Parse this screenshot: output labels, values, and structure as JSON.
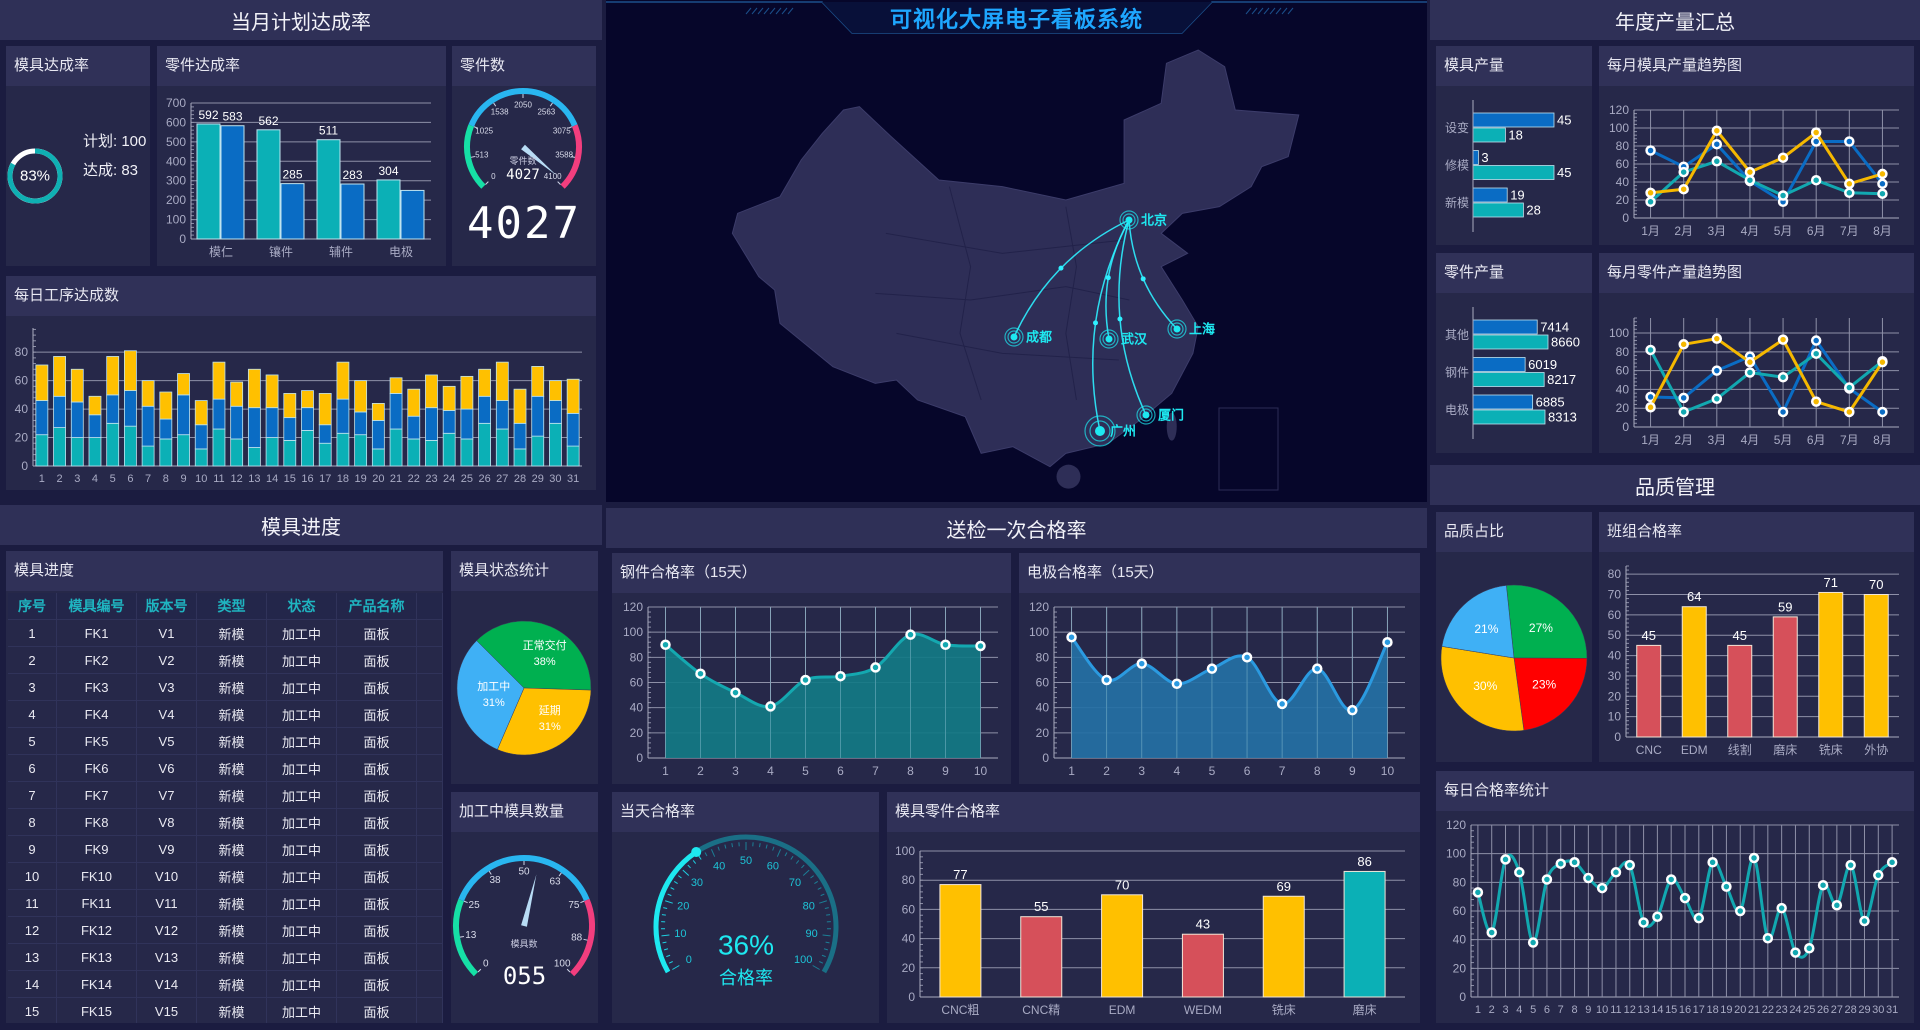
{
  "header": {
    "title": "可视化大屏电子看板系统"
  },
  "sections": {
    "monthly_plan": "当月计划达成率",
    "mold_progress": "模具进度",
    "inspection": "送检一次合格率",
    "annual_output": "年度产量汇总",
    "quality": "品质管理"
  },
  "colors": {
    "teal": "#0bb0b6",
    "blue": "#0a6cc4",
    "yellow": "#ffc000",
    "red": "#d6505a",
    "cyan": "#1ee8f0",
    "green": "#00b050",
    "light_blue": "#3fb0f5",
    "pie_red": "#ff0000"
  },
  "mold_rate": {
    "title": "模具达成率",
    "value": 83,
    "percent": "83%",
    "plan": "计划: 100",
    "done": "达成: 83"
  },
  "part_count": {
    "title": "零件数",
    "value": 4027,
    "max": 4100,
    "display": "4027",
    "gauge_label": "零件数",
    "ticks": [
      0,
      513,
      1025,
      1538,
      2050,
      2563,
      3075,
      3588,
      4100
    ]
  },
  "mold_table": {
    "title": "模具进度",
    "columns": [
      "序号",
      "模具编号",
      "版本号",
      "类型",
      "状态",
      "产品名称"
    ],
    "rows": [
      [
        "1",
        "FK1",
        "V1",
        "新模",
        "加工中",
        "面板"
      ],
      [
        "2",
        "FK2",
        "V2",
        "新模",
        "加工中",
        "面板"
      ],
      [
        "3",
        "FK3",
        "V3",
        "新模",
        "加工中",
        "面板"
      ],
      [
        "4",
        "FK4",
        "V4",
        "新模",
        "加工中",
        "面板"
      ],
      [
        "5",
        "FK5",
        "V5",
        "新模",
        "加工中",
        "面板"
      ],
      [
        "6",
        "FK6",
        "V6",
        "新模",
        "加工中",
        "面板"
      ],
      [
        "7",
        "FK7",
        "V7",
        "新模",
        "加工中",
        "面板"
      ],
      [
        "8",
        "FK8",
        "V8",
        "新模",
        "加工中",
        "面板"
      ],
      [
        "9",
        "FK9",
        "V9",
        "新模",
        "加工中",
        "面板"
      ],
      [
        "10",
        "FK10",
        "V10",
        "新模",
        "加工中",
        "面板"
      ],
      [
        "11",
        "FK11",
        "V11",
        "新模",
        "加工中",
        "面板"
      ],
      [
        "12",
        "FK12",
        "V12",
        "新模",
        "加工中",
        "面板"
      ],
      [
        "13",
        "FK13",
        "V13",
        "新模",
        "加工中",
        "面板"
      ],
      [
        "14",
        "FK14",
        "V14",
        "新模",
        "加工中",
        "面板"
      ],
      [
        "15",
        "FK15",
        "V15",
        "新模",
        "加工中",
        "面板"
      ]
    ]
  },
  "mold_gauge": {
    "title": "加工中模具数量",
    "value": 55,
    "max": 100,
    "display": "055",
    "gauge_label": "模具数",
    "ticks": [
      0,
      13,
      25,
      38,
      50,
      63,
      75,
      88,
      100
    ]
  },
  "today_rate": {
    "title": "当天合格率",
    "value": 36,
    "display": "36%",
    "label": "合格率",
    "ticks": [
      0,
      10,
      20,
      30,
      40,
      50,
      60,
      70,
      80,
      90,
      100
    ]
  },
  "map": {
    "cities": [
      "北京",
      "成都",
      "武汉",
      "上海",
      "厦门",
      "广州"
    ],
    "routes": [
      [
        "北京",
        "成都"
      ],
      [
        "北京",
        "武汉"
      ],
      [
        "北京",
        "上海"
      ],
      [
        "北京",
        "厦门"
      ],
      [
        "北京",
        "广州"
      ]
    ]
  },
  "chart_data": [
    {
      "type": "bar",
      "title": "零件达成率",
      "categories": [
        "模仁",
        "镶件",
        "辅件",
        "电极"
      ],
      "ylim": [
        0,
        700
      ],
      "yticks": [
        0,
        100,
        200,
        300,
        400,
        500,
        600,
        700
      ],
      "grid": true,
      "series": [
        {
          "values": [
            592,
            562,
            511,
            304
          ],
          "color": "#0bb0b6",
          "labels": [
            "592",
            "562",
            "511",
            "304"
          ]
        },
        {
          "values": [
            583,
            285,
            283,
            250
          ],
          "color": "#0a6cc4",
          "labels": [
            "583",
            "285",
            "283",
            ""
          ]
        }
      ]
    },
    {
      "type": "bar",
      "stacked": true,
      "title": "每日工序达成数",
      "categories": [
        "1",
        "2",
        "3",
        "4",
        "5",
        "6",
        "7",
        "8",
        "9",
        "10",
        "11",
        "12",
        "13",
        "14",
        "15",
        "16",
        "17",
        "18",
        "19",
        "20",
        "21",
        "22",
        "23",
        "24",
        "25",
        "26",
        "27",
        "28",
        "29",
        "30",
        "31"
      ],
      "ylim": [
        0,
        97
      ],
      "yticks": [
        0,
        20,
        40,
        60,
        80
      ],
      "grid": true,
      "series": [
        {
          "color": "#0bb0b6",
          "values": [
            22,
            27,
            20,
            20,
            30,
            28,
            14,
            19,
            22,
            12,
            26,
            19,
            13,
            20,
            18,
            25,
            16,
            23,
            22,
            12,
            26,
            19,
            18,
            23,
            19,
            30,
            26,
            12,
            21,
            30,
            14
          ]
        },
        {
          "color": "#0a6cc4",
          "values": [
            24,
            22,
            25,
            16,
            20,
            25,
            28,
            14,
            28,
            17,
            21,
            23,
            28,
            21,
            16,
            16,
            13,
            24,
            16,
            20,
            25,
            16,
            23,
            16,
            21,
            19,
            20,
            18,
            28,
            16,
            23
          ]
        },
        {
          "color": "#ffc000",
          "values": [
            25,
            28,
            23,
            13,
            27,
            28,
            18,
            19,
            15,
            17,
            26,
            17,
            27,
            23,
            17,
            12,
            22,
            26,
            22,
            12,
            11,
            19,
            23,
            17,
            23,
            19,
            27,
            24,
            21,
            14,
            24
          ]
        }
      ]
    },
    {
      "type": "bar",
      "orientation": "horizontal",
      "title": "模具产量",
      "categories": [
        "设变",
        "修模",
        "新模"
      ],
      "xlim": [
        0,
        45
      ],
      "series": [
        {
          "color": "#0a6cc4",
          "values": [
            45,
            3,
            19
          ]
        },
        {
          "color": "#0bb0b6",
          "values": [
            18,
            45,
            28
          ]
        }
      ]
    },
    {
      "type": "line",
      "title": "每月模具产量趋势图",
      "categories": [
        "1月",
        "2月",
        "3月",
        "4月",
        "5月",
        "6月",
        "7月",
        "8月"
      ],
      "ylim": [
        0,
        120
      ],
      "yticks": [
        0,
        20,
        40,
        60,
        80,
        100,
        120
      ],
      "grid": true,
      "series": [
        {
          "color": "#0a6cc4",
          "values": [
            75,
            57,
            82,
            41,
            18,
            85,
            85,
            38
          ]
        },
        {
          "color": "#12a8b0",
          "values": [
            18,
            51,
            63,
            42,
            25,
            42,
            28,
            27
          ]
        },
        {
          "color": "#f5b800",
          "values": [
            28,
            32,
            97,
            51,
            67,
            95,
            38,
            49
          ]
        }
      ]
    },
    {
      "type": "bar",
      "orientation": "horizontal",
      "title": "零件产量",
      "categories": [
        "其他",
        "钢件",
        "电极"
      ],
      "xlim": [
        0,
        8660
      ],
      "series": [
        {
          "color": "#0a6cc4",
          "values": [
            7414,
            6019,
            6885
          ]
        },
        {
          "color": "#0bb0b6",
          "values": [
            8660,
            8217,
            8313
          ]
        }
      ]
    },
    {
      "type": "line",
      "title": "每月零件产量趋势图",
      "categories": [
        "1月",
        "2月",
        "3月",
        "4月",
        "5月",
        "6月",
        "7月",
        "8月"
      ],
      "ylim": [
        0,
        116
      ],
      "yticks": [
        0,
        20,
        40,
        60,
        80,
        100
      ],
      "grid": true,
      "series": [
        {
          "color": "#0a6cc4",
          "values": [
            32,
            31,
            60,
            75,
            16,
            92,
            41,
            16
          ]
        },
        {
          "color": "#12a8b0",
          "values": [
            82,
            16,
            30,
            58,
            53,
            78,
            42,
            70
          ]
        },
        {
          "color": "#f5b800",
          "values": [
            21,
            88,
            94,
            69,
            93,
            27,
            16,
            69
          ]
        }
      ]
    },
    {
      "type": "pie",
      "title": "模具状态统计",
      "slices": [
        {
          "name": "正常交付",
          "value": 38,
          "label": "38%",
          "color": "#00b050"
        },
        {
          "name": "延期",
          "value": 31,
          "label": "31%",
          "color": "#ffc000"
        },
        {
          "name": "加工中",
          "value": 31,
          "label": "31%",
          "color": "#3fb0f5"
        }
      ]
    },
    {
      "type": "area",
      "smooth": true,
      "title": "钢件合格率（15天）",
      "categories": [
        "1",
        "2",
        "3",
        "4",
        "5",
        "6",
        "7",
        "8",
        "9",
        "10"
      ],
      "ylim": [
        0,
        120
      ],
      "yticks": [
        0,
        20,
        40,
        60,
        80,
        100,
        120
      ],
      "grid": true,
      "series": [
        {
          "color": "#14a8b0",
          "fill": "#127a86",
          "values": [
            90,
            67,
            52,
            41,
            62,
            65,
            72,
            98,
            90,
            89
          ]
        }
      ]
    },
    {
      "type": "area",
      "smooth": true,
      "title": "电极合格率（15天）",
      "categories": [
        "1",
        "2",
        "3",
        "4",
        "5",
        "6",
        "7",
        "8",
        "9",
        "10"
      ],
      "ylim": [
        0,
        120
      ],
      "yticks": [
        0,
        20,
        40,
        60,
        80,
        100,
        120
      ],
      "grid": true,
      "series": [
        {
          "color": "#2b9ae0",
          "fill": "#2470a5",
          "values": [
            96,
            62,
            75,
            59,
            71,
            80,
            43,
            71,
            38,
            92
          ]
        }
      ]
    },
    {
      "type": "bar",
      "title": "模具零件合格率",
      "categories": [
        "CNC粗",
        "CNC精",
        "EDM",
        "WEDM",
        "铣床",
        "磨床"
      ],
      "ylim": [
        0,
        100
      ],
      "yticks": [
        0,
        20,
        40,
        60,
        80,
        100
      ],
      "grid": true,
      "values": [
        77,
        55,
        70,
        43,
        69,
        86
      ],
      "colors": [
        "#ffc000",
        "#d6505a",
        "#ffc000",
        "#d6505a",
        "#ffc000",
        "#0bb0b6"
      ]
    },
    {
      "type": "pie",
      "title": "品质占比",
      "slices": [
        {
          "value": 27,
          "label": "27%",
          "color": "#00b050"
        },
        {
          "value": 23,
          "label": "23%",
          "color": "#ff0000"
        },
        {
          "value": 30,
          "label": "30%",
          "color": "#ffc000"
        },
        {
          "value": 21,
          "label": "21%",
          "color": "#3fb0f5"
        }
      ]
    },
    {
      "type": "bar",
      "title": "班组合格率",
      "categories": [
        "CNC",
        "EDM",
        "线割",
        "磨床",
        "铣床",
        "外协"
      ],
      "ylim": [
        0,
        84
      ],
      "yticks": [
        0,
        10,
        20,
        30,
        40,
        50,
        60,
        70,
        80
      ],
      "grid": true,
      "values": [
        45,
        64,
        45,
        59,
        71,
        70
      ],
      "colors": [
        "#d6505a",
        "#ffc000",
        "#d6505a",
        "#d6505a",
        "#ffc000",
        "#ffc000"
      ]
    },
    {
      "type": "line",
      "smooth": true,
      "title": "每日合格率统计",
      "categories": [
        "1",
        "2",
        "3",
        "4",
        "5",
        "6",
        "7",
        "8",
        "9",
        "10",
        "11",
        "12",
        "13",
        "14",
        "15",
        "16",
        "17",
        "18",
        "19",
        "20",
        "21",
        "22",
        "23",
        "24",
        "25",
        "26",
        "27",
        "28",
        "29",
        "30",
        "31"
      ],
      "ylim": [
        0,
        120
      ],
      "yticks": [
        0,
        20,
        40,
        60,
        80,
        100,
        120
      ],
      "grid": true,
      "series": [
        {
          "color": "#12a8b0",
          "values": [
            73,
            45,
            96,
            87,
            38,
            82,
            93,
            94,
            83,
            76,
            87,
            92,
            52,
            56,
            82,
            69,
            55,
            94,
            77,
            60,
            97,
            41,
            62,
            31,
            34,
            78,
            64,
            92,
            53,
            85,
            94
          ]
        }
      ]
    }
  ]
}
